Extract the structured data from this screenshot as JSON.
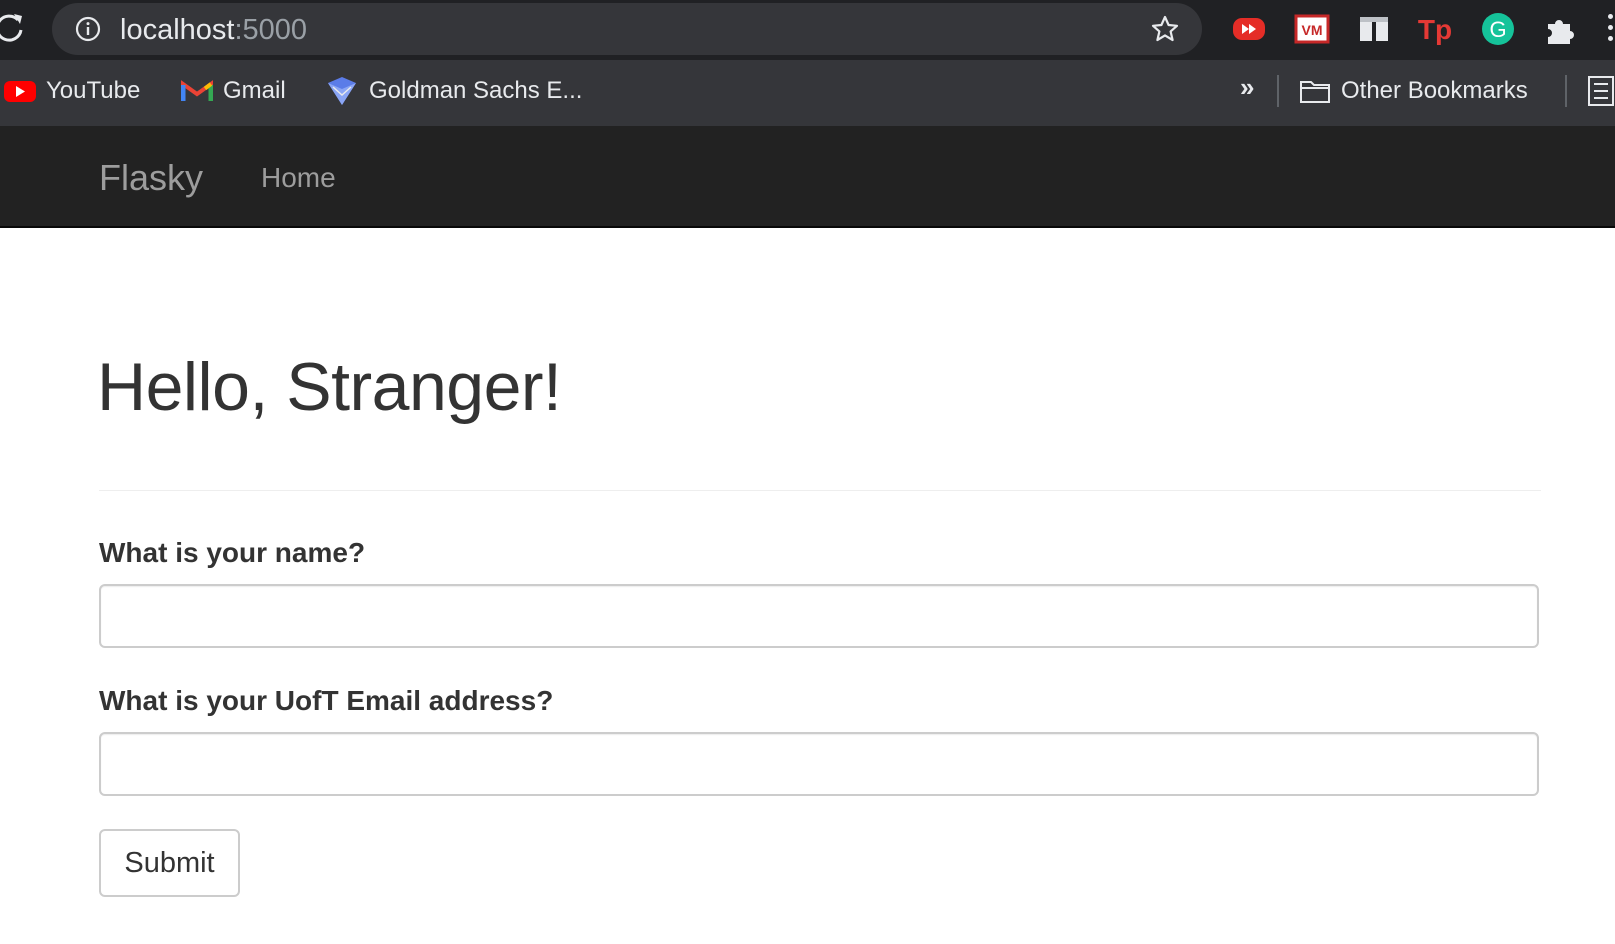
{
  "browser": {
    "url_host": "localhost",
    "url_port": ":5000",
    "bookmarks": [
      {
        "label": "YouTube",
        "icon": "youtube-icon"
      },
      {
        "label": "Gmail",
        "icon": "gmail-icon"
      },
      {
        "label": "Goldman Sachs E...",
        "icon": "goldman-sachs-icon"
      }
    ],
    "overflow_label": "»",
    "other_bookmarks_label": "Other Bookmarks",
    "extensions": [
      "youtube-ext-icon",
      "vm-ext-icon",
      "reader-ext-icon",
      "tp-ext-icon",
      "grammarly-ext-icon",
      "puzzle-extensions-icon"
    ]
  },
  "navbar": {
    "brand": "Flasky",
    "links": [
      "Home"
    ]
  },
  "page": {
    "heading": "Hello, Stranger!",
    "form": {
      "name_label": "What is your name?",
      "name_value": "",
      "email_label": "What is your UofT Email address?",
      "email_value": "",
      "submit_label": "Submit"
    }
  },
  "colors": {
    "chrome_dark": "#202124",
    "bookmarks_bar": "#35363a",
    "navbar": "#222222",
    "navbar_text": "#9d9d9d",
    "text": "#333333"
  }
}
